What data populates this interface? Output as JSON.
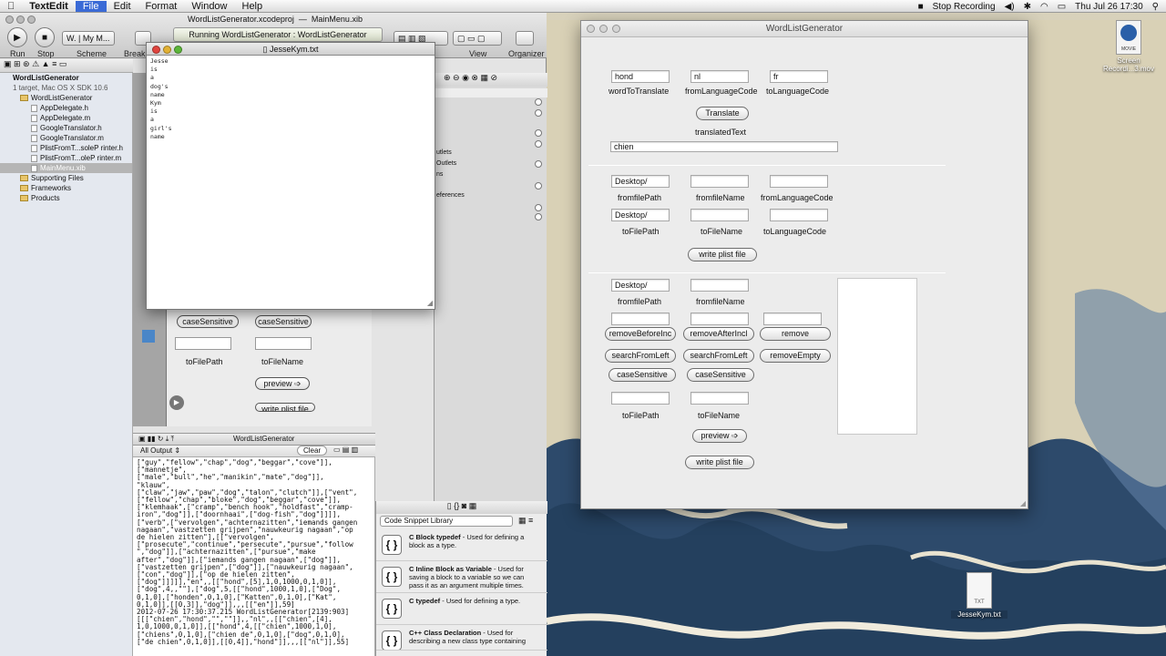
{
  "menubar": {
    "app_name": "TextEdit",
    "items": [
      "File",
      "Edit",
      "Format",
      "Window",
      "Help"
    ],
    "status_recording": "Stop Recording",
    "clock": "Thu Jul 26  17:30"
  },
  "xcode": {
    "toolbar": {
      "run_label": "Run",
      "stop_label": "Stop",
      "scheme_label": "Scheme",
      "breakpoints_label": "Breakp",
      "scheme_value": "W.",
      "destination_value": "My M...",
      "view_label": "View",
      "organizer_label": "Organizer",
      "window_title": "WordListGenerator.xcodeproj",
      "file_title": "MainMenu.xib",
      "status_text": "Running WordListGenerator : WordListGenerator"
    },
    "navigator": {
      "project_name": "WordListGenerator",
      "project_sub": "1 target, Mac OS X SDK 10.6",
      "items": [
        {
          "label": "WordListGenerator",
          "kind": "folder"
        },
        {
          "label": "AppDelegate.h",
          "kind": "file"
        },
        {
          "label": "AppDelegate.m",
          "kind": "file"
        },
        {
          "label": "GoogleTranslator.h",
          "kind": "file"
        },
        {
          "label": "GoogleTranslator.m",
          "kind": "file"
        },
        {
          "label": "PlistFromT...soleP rinter.h",
          "kind": "file"
        },
        {
          "label": "PlistFromT...oleP rinter.m",
          "kind": "file"
        },
        {
          "label": "MainMenu.xib",
          "kind": "file"
        },
        {
          "label": "Supporting Files",
          "kind": "folder"
        },
        {
          "label": "Frameworks",
          "kind": "folder"
        },
        {
          "label": "Products",
          "kind": "folder"
        }
      ]
    },
    "ib": {
      "case_sensitive_1": "caseSensitive",
      "case_sensitive_2": "caseSensitive",
      "to_file_path": "toFilePath",
      "to_file_name": "toFileName",
      "preview": "preview ➩",
      "write_plist": "write plist file"
    },
    "inspector": {
      "outlets": "utlets",
      "outlets2": "Outlets",
      "actions": "ns",
      "references": "eferences"
    },
    "debug": {
      "target": "WordListGenerator",
      "output_select": "All Output ⇕",
      "clear": "Clear"
    },
    "console_text": "[\"guy\",\"fellow\",\"chap\",\"dog\",\"beggar\",\"cove\"]],\n[\"mannetje\",\n[\"male\",\"bull\",\"he\",\"manikin\",\"mate\",\"dog\"]],\n\"klauw\",\n[\"claw\",\"jaw\",\"paw\",\"dog\",\"talon\",\"clutch\"]],[\"vent\",\n[\"fellow\",\"chap\",\"bloke\",\"dog\",\"beggar\",\"cove\"]],\n[\"klemhaak\",[\"cramp\",\"bench hook\",\"holdfast\",\"cramp-\niron\",\"dog\"]],[\"doornhaai\",[\"dog-fish\",\"dog\"]]]],\n[\"verb\",[\"vervolgen\",\"achternazitten\",\"iemands gangen\nnagaan\",\"vastzetten grijpen\",\"nauwkeurig nagaan\",\"op\nde hielen zitten\"],[[\"vervolgen\",\n[\"prosecute\",\"continue\",\"persecute\",\"pursue\",\"follow\n\",\"dog\"]],[\"achternazitten\",[\"pursue\",\"make\nafter\",\"dog\"]],[\"iemands gangen nagaan\",[\"dog\"]],\n[\"vastzetten grijpen\",[\"dog\"]],[\"nauwkeurig nagaan\",\n[\"con\",\"dog\"]],[\"op de hielen zitten\",\n[\"dog\"]]]]],\"en\",,[[\"hond\",[5],1,0,1000,0,1,0]],\n[\"dog\",4,,\"\"],[\"dog\",5,[[\"hond\",1000,1,0],[\"Dog\",\n0,1,0],[\"honden\",0,1,0],[\"Katten\",0,1,0],[\"Kat\",\n0,1,0]],[[0,3]],\"dog\"]],,,[[\"en\"]],59]\n2012-07-26 17:30:37.215 WordListGenerator[2139:903]\n[[[\"chien\",\"hond\",\"\",\"\"]],,\"nl\",,[[\"chien\",[4],\n1,0,1000,0,1,0]],[[\"hond\",4,[[\"chien\",1000,1,0],\n[\"chiens\",0,1,0],[\"chien de\",0,1,0],[\"dog\",0,1,0],\n[\"de chien\",0,1,0]],[[0,4]],\"hond\"]],,,[[\"nl\"]],55]",
    "snippets": {
      "library_select": "Code Snippet Library",
      "items": [
        {
          "title": "C Block typedef",
          "desc": " - Used for defining a block as a type."
        },
        {
          "title": "C Inline Block as Variable",
          "desc": " - Used for saving a block to a variable so we can pass it as an argument multiple times."
        },
        {
          "title": "C typedef",
          "desc": " - Used for defining a type."
        },
        {
          "title": "C++ Class Declaration",
          "desc": " - Used for describing a new class type containing"
        }
      ]
    }
  },
  "textedit": {
    "title": "JesseKym.txt",
    "lines": [
      "Jesse",
      "is",
      "a",
      "dog's",
      "name",
      "Kym",
      "is",
      "a",
      "girl's",
      "name"
    ]
  },
  "wlg": {
    "title": "WordListGenerator",
    "translate": {
      "word_value": "hond",
      "from_value": "nl",
      "to_value": "fr",
      "word_label": "wordToTranslate",
      "from_label": "fromLanguageCode",
      "to_label": "toLanguageCode",
      "translate_button": "Translate",
      "translated_label": "translatedText",
      "translated_value": "chien"
    },
    "section2": {
      "from_path_value": "Desktop/",
      "from_path_label": "fromfilePath",
      "from_name_label": "fromfileName",
      "from_lang_label": "fromLanguageCode",
      "to_path_value": "Desktop/",
      "to_path_label": "toFilePath",
      "to_name_label": "toFileName",
      "to_lang_label": "toLanguageCode",
      "write_button": "write plist file"
    },
    "section3": {
      "from_path_value": "Desktop/",
      "from_path_label": "fromfilePath",
      "from_name_label": "fromfileName",
      "remove_before": "removeBeforeInc",
      "remove_after": "removeAfterIncl",
      "remove": "remove",
      "search_left_1": "searchFromLeft",
      "search_left_2": "searchFromLeft",
      "remove_empty": "removeEmpty",
      "case_1": "caseSensitive",
      "case_2": "caseSensitive",
      "to_path_label": "toFilePath",
      "to_name_label": "toFileName",
      "preview_button": "preview ➩",
      "write_button": "write plist file"
    }
  },
  "desktop": {
    "screen_recording_label": "Screen Recordi...3.mov",
    "movie_badge": "MOVIE",
    "file_label": "JesseKym.txt",
    "file_badge": "TXT"
  }
}
